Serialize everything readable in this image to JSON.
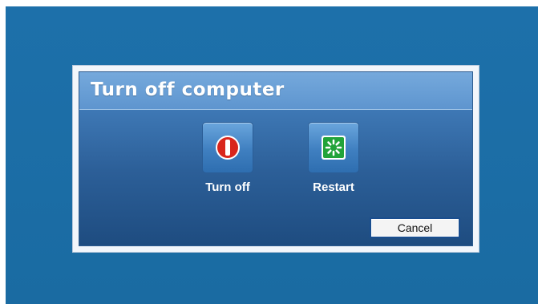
{
  "dialog": {
    "title": "Turn off computer",
    "options": [
      {
        "label": "Turn off",
        "icon": "power-icon",
        "color": "#d9261c"
      },
      {
        "label": "Restart",
        "icon": "restart-icon",
        "color": "#22a33a"
      }
    ],
    "cancel_label": "Cancel"
  },
  "colors": {
    "desktop": "#1c6ea6",
    "title_bar": "#6ea3d6",
    "body_gradient_bottom": "#1e4c80"
  }
}
